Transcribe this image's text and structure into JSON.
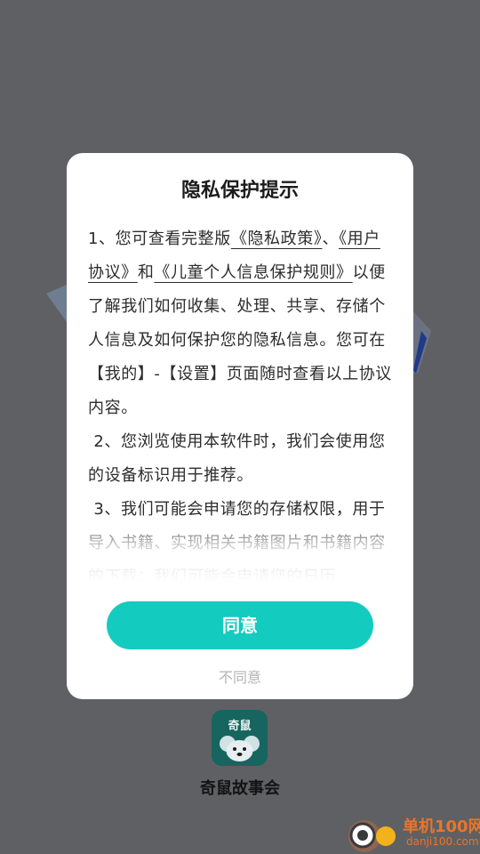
{
  "dialog": {
    "title": "隐私保护提示",
    "p1": {
      "prefix": "1、您可查看完整版",
      "link_privacy": "《隐私政策》",
      "sep": "、",
      "link_user": "《用户协议》",
      "and": "和",
      "link_child": "《儿童个人信息保护规则》",
      "rest": "以便了解我们如何收集、处理、共享、存储个人信息及如何保护您的隐私信息。您可在【我的】-【设置】页面随时查看以上协议内容。"
    },
    "p2": " 2、您浏览使用本软件时，我们会使用您的设备标识用于推荐。",
    "p3": " 3、我们可能会申请您的存储权限，用于导入书籍、实现相关书籍图片和书籍内容的下载；我们可能会申请您的日历",
    "agree_label": "同意",
    "disagree_label": "不同意"
  },
  "app": {
    "name": "奇鼠故事会",
    "icon_text": "奇鼠",
    "icon": "mouse-icon"
  },
  "watermark": {
    "line1": "单机100网",
    "line2": "danji100.com"
  },
  "colors": {
    "accent": "#14cbbf",
    "overlay": "#5f6064",
    "app_icon_bg": "#17655f",
    "watermark": "#e8762a"
  }
}
